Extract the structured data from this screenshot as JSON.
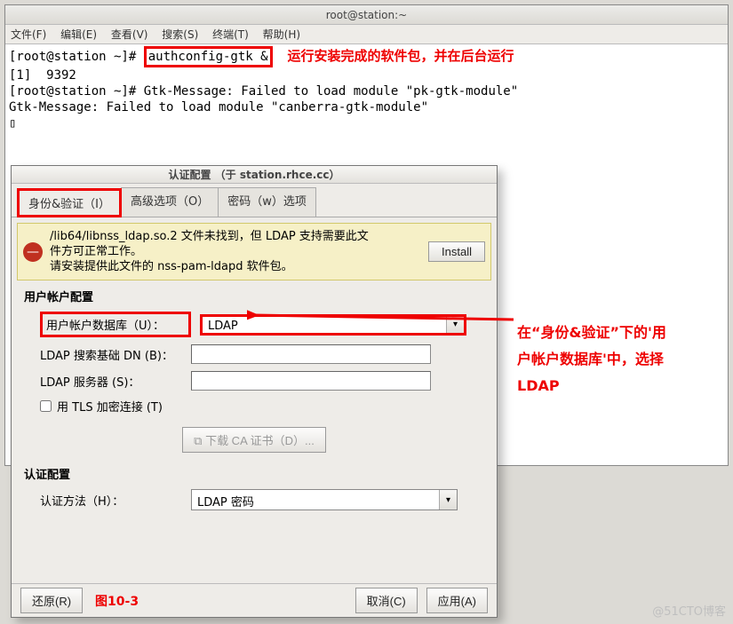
{
  "terminal": {
    "title": "root@station:~",
    "menu": [
      "文件(F)",
      "编辑(E)",
      "查看(V)",
      "搜索(S)",
      "终端(T)",
      "帮助(H)"
    ],
    "prompt1": "[root@station ~]# ",
    "cmd_hl": "authconfig-gtk &",
    "anno_cmd": "运行安装完成的软件包，并在后台运行",
    "line2": "[1]  9392",
    "line3": "[root@station ~]# Gtk-Message: Failed to load module \"pk-gtk-module\"",
    "line4": "Gtk-Message: Failed to load module \"canberra-gtk-module\"",
    "cursor": "▯"
  },
  "dialog": {
    "title": "认证配置 （于  station.rhce.cc）",
    "tabs": [
      "身份&验证（I）",
      "高级选项（O）",
      "密码（w）选项"
    ],
    "warning": {
      "l1": "/lib64/libnss_ldap.so.2 文件未找到，但 LDAP 支持需要此文",
      "l2": "件方可正常工作。",
      "l3": "请安装提供此文件的 nss-pam-ldapd 软件包。",
      "install": "Install"
    },
    "user_section": "用户帐户配置",
    "db_label": "用户帐户数据库（U）：",
    "db_value": "LDAP",
    "search_dn_label": "LDAP 搜索基础 DN (B)：",
    "server_label": "LDAP 服务器 (S)：",
    "tls_label": "用 TLS 加密连接 (T)",
    "download_ca": "下载 CA 证书（D）...",
    "auth_section": "认证配置",
    "auth_method_label": "认证方法（H）：",
    "auth_method_value": "LDAP 密码",
    "footer": {
      "revert": "还原(R)",
      "cancel": "取消(C)",
      "apply": "应用(A)",
      "fig": "图10-3"
    }
  },
  "anno_side": {
    "l1": "在“身份&验证”下的'用",
    "l2": "户帐户数据库'中，选择",
    "l3": "LDAP"
  },
  "watermark": "@51CTO博客"
}
